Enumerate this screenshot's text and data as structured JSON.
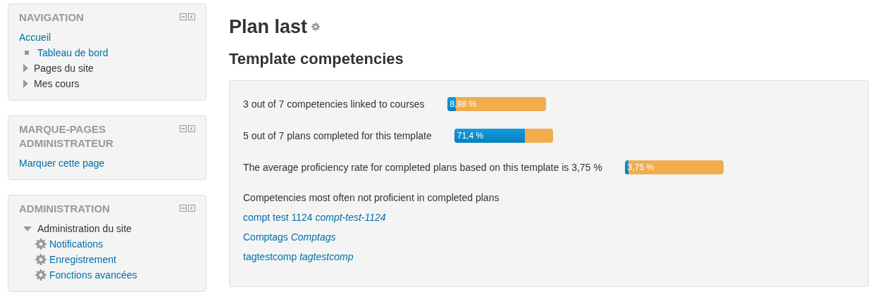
{
  "blocks": [
    {
      "title": "NAVIGATION",
      "items": [
        {
          "label": "Accueil",
          "kind": "link"
        },
        {
          "label": "Tableau de bord",
          "kind": "leaf"
        },
        {
          "label": "Pages du site",
          "kind": "branch",
          "expanded": false
        },
        {
          "label": "Mes cours",
          "kind": "branch",
          "expanded": false
        }
      ]
    },
    {
      "title": "MARQUE-PAGES ADMINISTRATEUR",
      "items": [
        {
          "label": "Marquer cette page",
          "kind": "link"
        }
      ]
    },
    {
      "title": "ADMINISTRATION",
      "items": [
        {
          "label": "Administration du site",
          "kind": "branch",
          "expanded": true,
          "children": [
            {
              "label": "Notifications",
              "kind": "setting"
            },
            {
              "label": "Enregistrement",
              "kind": "setting"
            },
            {
              "label": "Fonctions avancées",
              "kind": "setting"
            }
          ]
        }
      ]
    }
  ],
  "main": {
    "title": "Plan last",
    "subtitle": "Template competencies",
    "stats": [
      {
        "text": "3 out of 7 competencies linked to courses",
        "level": 0.0898,
        "reading": "8,98 %"
      },
      {
        "text": "5 out of 7 plans completed for this template",
        "level": 0.714,
        "reading": "71,4 %"
      },
      {
        "text": "The average proficiency rate for completed plans based on this template is 3,75 %",
        "level": 0.0375,
        "reading": "3,75 %"
      }
    ],
    "list_heading": "Competencies most often not proficient in completed plans",
    "competencies": [
      {
        "name": "compt test 1124",
        "idnumber": "compt-test-1124"
      },
      {
        "name": "Comptags",
        "idnumber": "Comptags"
      },
      {
        "name": "tagtestcomp",
        "idnumber": "tagtestcomp"
      }
    ]
  }
}
